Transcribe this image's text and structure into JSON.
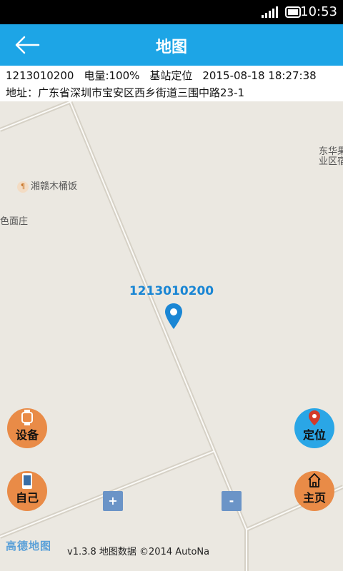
{
  "status_bar": {
    "time": "10:53",
    "signal_icon": "signal-icon",
    "battery_icon": "battery-icon"
  },
  "header": {
    "title": "地图",
    "back_icon": "back-arrow-icon"
  },
  "info": {
    "device_id": "1213010200",
    "battery": "电量:100%",
    "locate_mode": "基站定位",
    "datetime": "2015-08-18 18:27:38",
    "address": "地址：广东省深圳市宝安区西乡街道三围中路23-1"
  },
  "map": {
    "poi_restaurant": "湘赣木桶饭",
    "poi_left": "色面庄",
    "poi_right_line1": "东华果",
    "poi_right_line2": "业区宿",
    "marker_label": "1213010200",
    "logo": "高德地图",
    "version_text": "v1.3.8 地图数据 ©2014 AutoNa"
  },
  "buttons": {
    "device": "设备",
    "self": "自己",
    "locate": "定位",
    "home": "主页",
    "zoom_in": "+",
    "zoom_out": "-"
  },
  "colors": {
    "header": "#1da5e6",
    "orange_button": "#e98b47",
    "blue_button": "#2aa6e6",
    "zoom_button": "#6b94c7",
    "marker": "#1a86d4"
  }
}
